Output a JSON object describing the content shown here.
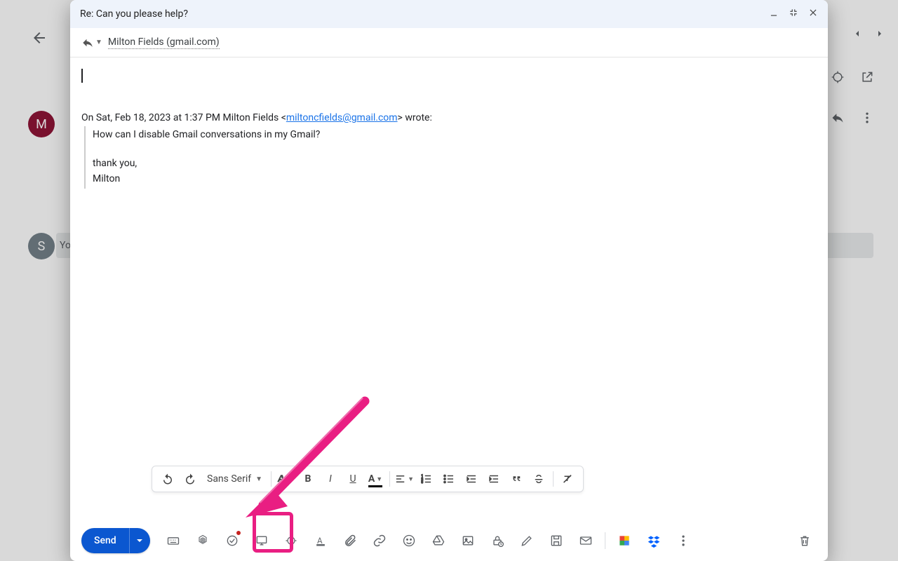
{
  "header": {
    "subject": "Re: Can you please help?"
  },
  "recipient": {
    "display": "Milton Fields (gmail.com)"
  },
  "quote": {
    "intro_pre": "On Sat, Feb 18, 2023 at 1:37 PM Milton Fields <",
    "email": "miltoncfields@gmail.com",
    "intro_post": "> wrote:",
    "line1": "How can I disable Gmail conversations in my Gmail?",
    "line2": "thank you,",
    "line3": "Milton"
  },
  "format": {
    "font_name": "Sans Serif"
  },
  "send": {
    "label": "Send"
  },
  "bg": {
    "avatar1": "M",
    "avatar2": "S",
    "yo": "Yo"
  }
}
